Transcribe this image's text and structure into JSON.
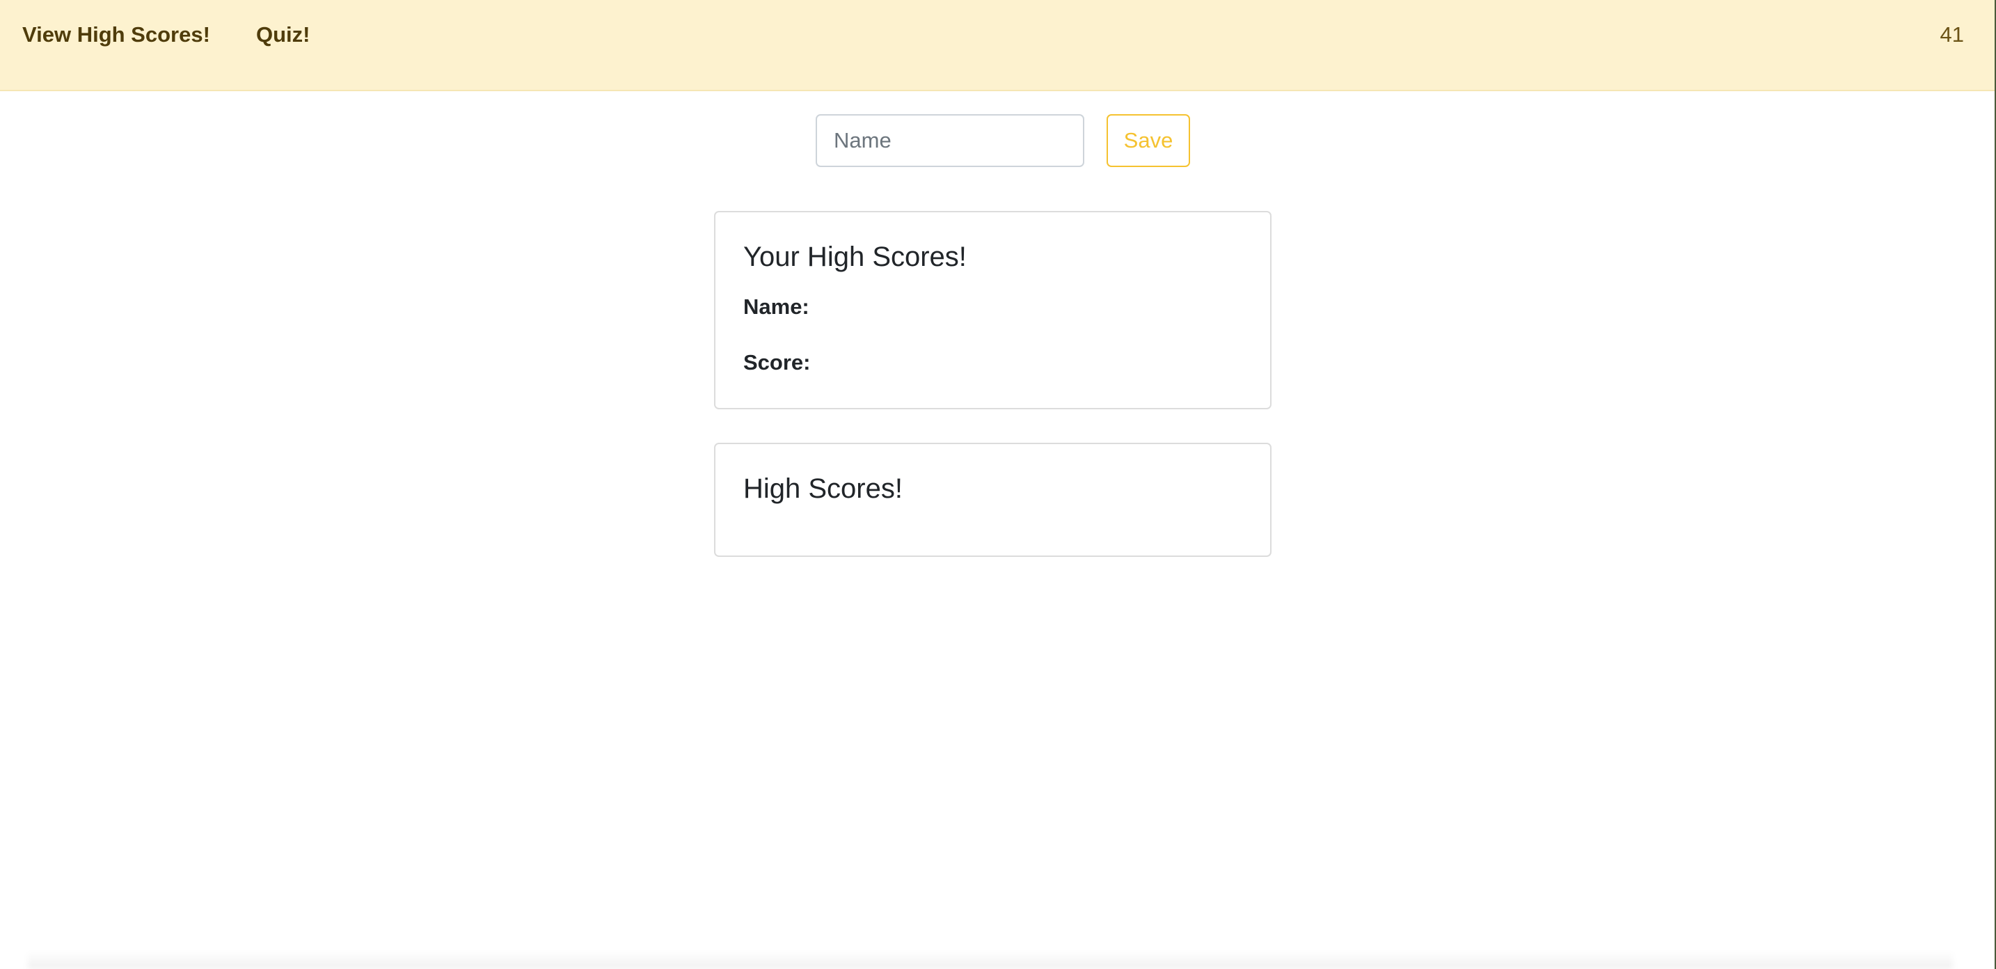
{
  "navbar": {
    "high_scores_link": "View High Scores!",
    "quiz_link": "Quiz!",
    "timer": "41"
  },
  "form": {
    "name_placeholder": "Name",
    "name_value": "",
    "save_label": "Save"
  },
  "your_scores_card": {
    "title": "Your High Scores!",
    "name_label": "Name:",
    "score_label": "Score:"
  },
  "high_scores_card": {
    "title": "High Scores!"
  },
  "colors": {
    "navbar_bg": "#fdf2cf",
    "nav_text": "#4f3c0b",
    "accent_warning": "#f5c230",
    "text": "#212529",
    "card_border": "#dcdcdc"
  }
}
